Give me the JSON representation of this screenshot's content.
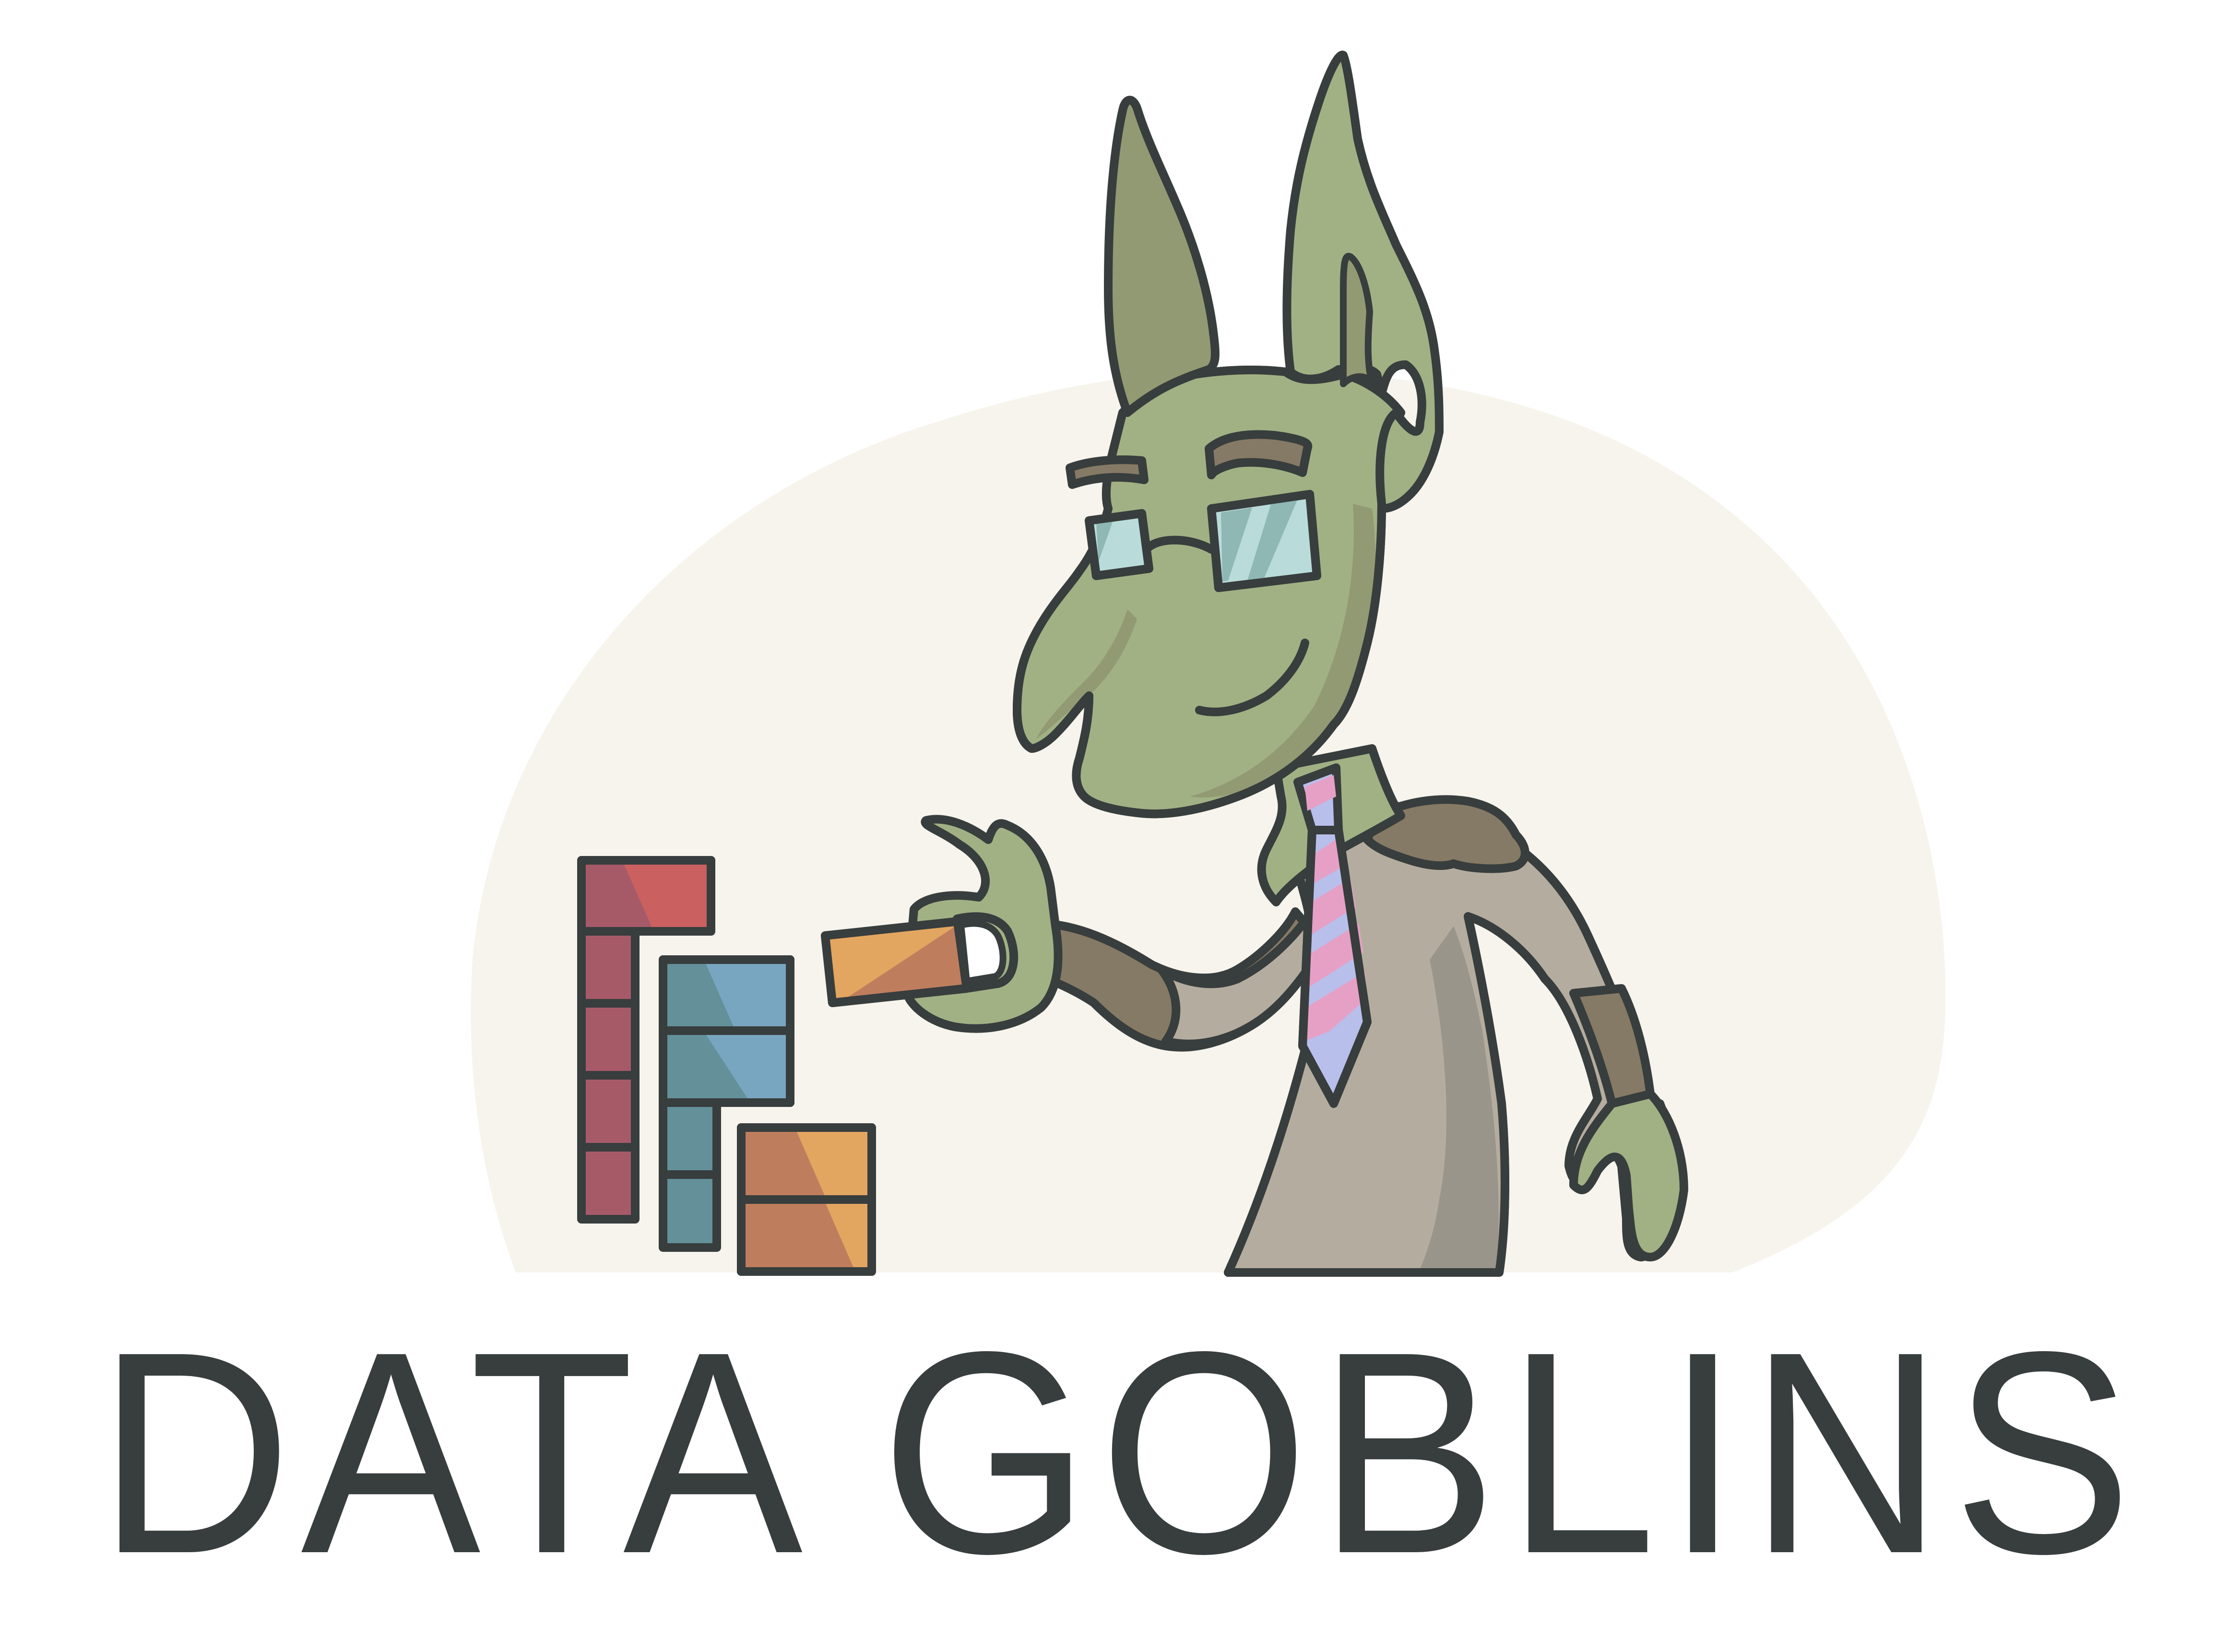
{
  "logo": {
    "wordmark": "DATA GOBLINS"
  },
  "colors": {
    "background": "#ffffff",
    "halo": "#f6f4ec",
    "outline": "#383d3d",
    "goblin_skin": "#a1b184",
    "goblin_skin_shadow": "#929a73",
    "suit": "#b4ad9f",
    "suit_shadow": "#9a958a",
    "sleeve": "#857a65",
    "glasses_lens": "#b9dcda",
    "tie_pink": "#e6a0c6",
    "tie_blue": "#b8bfeb",
    "bar_red": "#a65a68",
    "bar_red_light": "#cb6060",
    "bar_teal": "#639099",
    "bar_teal_light": "#78a6c0",
    "bar_orange": "#be7e5e",
    "bar_orange_light": "#e3a660",
    "wordmark": "#383d3d"
  },
  "icons": [
    "goblin-mascot-icon",
    "stacked-bars-icon",
    "data-block-icon"
  ]
}
